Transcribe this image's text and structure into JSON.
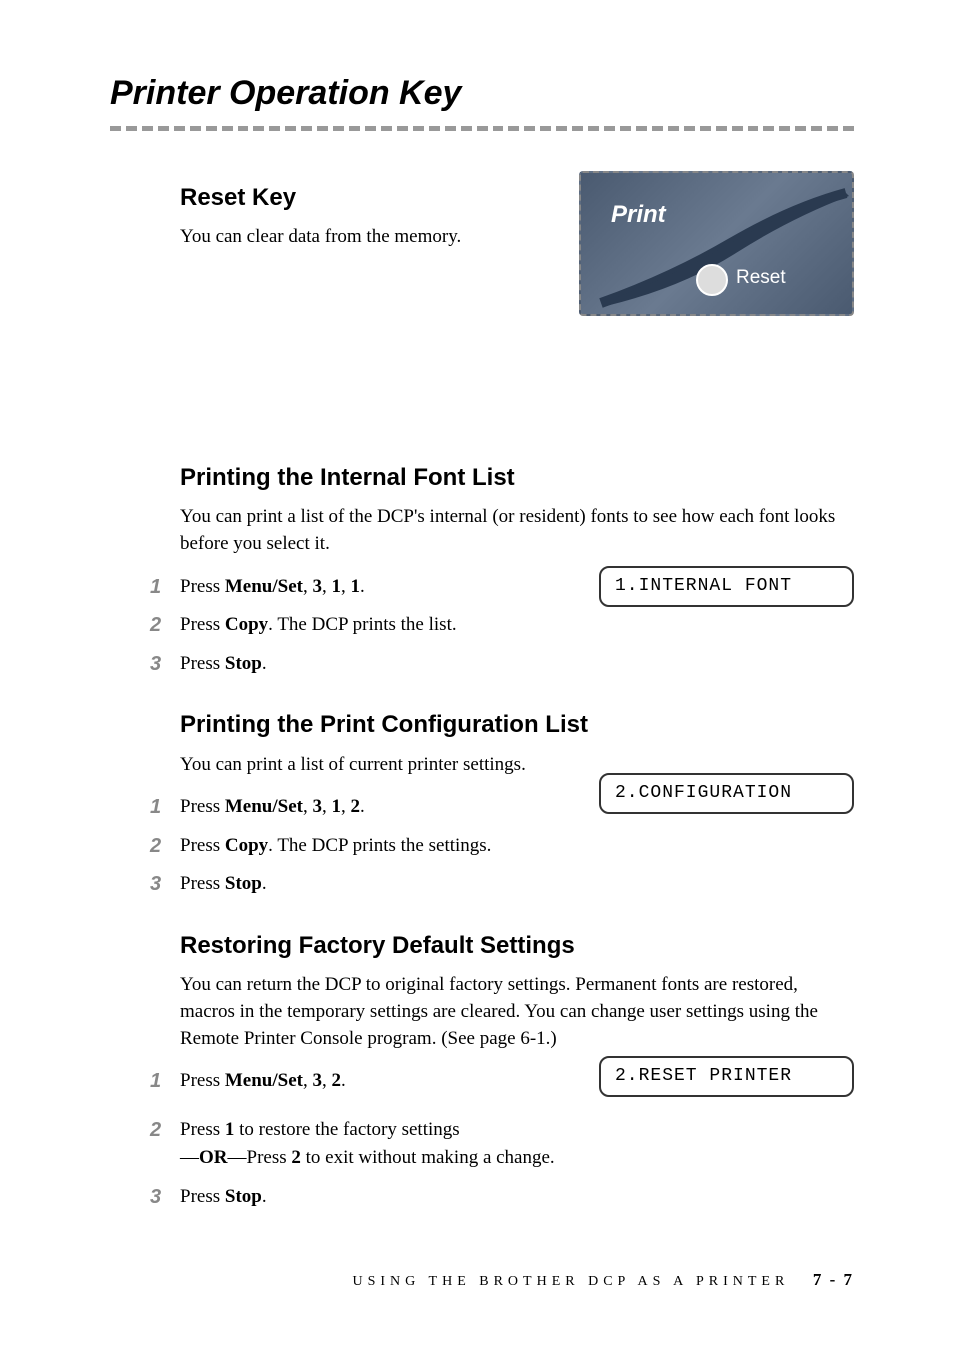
{
  "main_title": "Printer Operation Key",
  "reset_section": {
    "title": "Reset Key",
    "body": "You can clear data from the memory.",
    "graphic": {
      "print_label": "Print",
      "reset_label": "Reset"
    }
  },
  "font_list_section": {
    "title": "Printing the Internal Font List",
    "body": "You can print a list of the DCP's internal (or resident) fonts to see how each font looks before you select it.",
    "lcd": "1.INTERNAL FONT",
    "steps": [
      {
        "num": "1",
        "prefix": "Press ",
        "bold1": "Menu/Set",
        "mid1": ", ",
        "bold2": "3",
        "mid2": ", ",
        "bold3": "1",
        "mid3": ", ",
        "bold4": "1",
        "suffix": "."
      },
      {
        "num": "2",
        "prefix": "Press ",
        "bold1": "Copy",
        "suffix": ". The DCP prints the list."
      },
      {
        "num": "3",
        "prefix": "Press ",
        "bold1": "Stop",
        "suffix": "."
      }
    ]
  },
  "config_section": {
    "title": "Printing the Print Configuration List",
    "body": "You can print a list of current printer settings.",
    "lcd": "2.CONFIGURATION",
    "steps": [
      {
        "num": "1",
        "prefix": "Press ",
        "bold1": "Menu/Set",
        "mid1": ", ",
        "bold2": "3",
        "mid2": ", ",
        "bold3": "1",
        "mid3": ", ",
        "bold4": "2",
        "suffix": "."
      },
      {
        "num": "2",
        "prefix": "Press ",
        "bold1": "Copy",
        "suffix": ". The DCP prints the settings."
      },
      {
        "num": "3",
        "prefix": "Press ",
        "bold1": "Stop",
        "suffix": "."
      }
    ]
  },
  "restore_section": {
    "title": "Restoring Factory Default Settings",
    "body": "You can return the DCP to original factory settings.  Permanent fonts are restored, macros in the temporary settings are cleared.  You can change user settings using the Remote Printer Console program. (See page 6-1.)",
    "lcd": "2.RESET PRINTER",
    "steps": [
      {
        "num": "1",
        "prefix": "Press ",
        "bold1": "Menu/Set",
        "mid1": ", ",
        "bold2": "3",
        "mid2": ", ",
        "bold3": "2",
        "suffix": "."
      },
      {
        "num": "2",
        "prefix": "Press ",
        "bold1": "1",
        "mid1": " to restore the factory settings",
        "line2_prefix": "—",
        "line2_bold": "OR",
        "line2_mid": "—Press ",
        "line2_bold2": "2",
        "line2_suffix": " to exit without making a change."
      },
      {
        "num": "3",
        "prefix": "Press ",
        "bold1": "Stop",
        "suffix": "."
      }
    ]
  },
  "footer": {
    "text": "USING THE BROTHER DCP AS A PRINTER",
    "page": "7 - 7"
  }
}
